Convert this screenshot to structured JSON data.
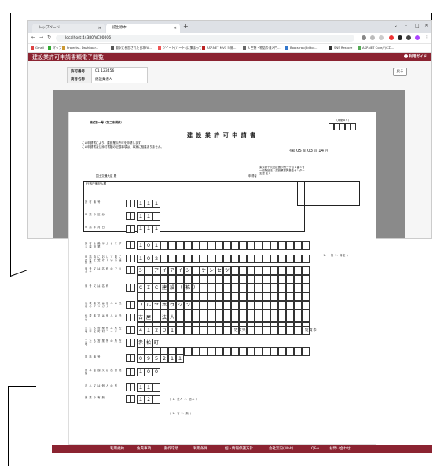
{
  "browser": {
    "tabs": [
      {
        "label": "トップページ"
      },
      {
        "label": "提出原本"
      }
    ],
    "url": "localhost:44380/VC00006",
    "bookmarks": [
      "Gmail",
      "マップ",
      "Projects - Dashboar...",
      "翻訳に参加された日本FA...",
      "ツイート(ハート)(に集まって...",
      "ASP.NET MVC 5 開...",
      "A 空想・物語の海入門...",
      "Bootstrap(Editor...",
      "SNS Restore",
      "ASP.NET Core/F/Cエ..."
    ]
  },
  "app": {
    "title": "建設業許可申請書類電子閲覧",
    "guide": "利用ガイド",
    "back": "戻る",
    "info": [
      {
        "key": "許可番号",
        "value": "01 123456"
      },
      {
        "key": "商号名称",
        "value": "建設業者A"
      }
    ]
  },
  "document": {
    "form_no": "様式第一号（第二条関係）",
    "stamp": "（用紙A４）",
    "title": "建 設 業 許 可 申 請 書",
    "intro1": "この申請書により、建設業の許可を申請します。",
    "intro2": "この申請書及び添付書類の記載事項は、事実に相違ありません。",
    "date": {
      "era": "令和",
      "y": "05",
      "y_unit": "年",
      "m": "03",
      "m_unit": "月",
      "d": "14",
      "d_unit": "日"
    },
    "addressee": "国土交通大臣 殿",
    "applicant": "申請者",
    "address_lines": [
      "東京都千代田区霞が関二丁目１番３号",
      "一般財団法人建設業振興基金センター",
      "古屋 五人"
    ],
    "section_header": "行政庁側記入欄",
    "fields": [
      {
        "label": "許 可 番 号",
        "chars": [
          "１",
          "１",
          "１"
        ]
      },
      {
        "label": "申 請 の 区 分",
        "chars": [
          "１",
          "１"
        ]
      },
      {
        "label": "申 請 年 月 日",
        "chars": [
          "１",
          "１",
          "１"
        ]
      },
      {
        "label": "許 可 を 受 け よ う と す る 建 設 業",
        "chars": [
          "１",
          "０",
          "１"
        ]
      },
      {
        "label": "申 請 時 に お い て 既 に 許 可 を 受 け て い る 建 設 業",
        "chars": [
          "１",
          "０",
          "２"
        ]
      },
      {
        "label": "商 号 又 は 名 称 の フ リ ガ ナ",
        "chars": [
          "シ",
          "ー",
          "ア",
          "イ",
          "ア",
          "イ",
          "シ",
          "ー",
          "ケ",
          "ン",
          "セ",
          "ツ"
        ]
      },
      {
        "label": "商 号 又 は 名 称",
        "chars": [
          "Ｃ",
          "Ｉ",
          "Ｃ",
          "建",
          "設",
          "（",
          "株",
          "）"
        ]
      },
      {
        "label": "代 表 者 又 は 個 人 の 氏 名 の フ リ ガ ナ",
        "chars": [
          "フ",
          "ル",
          "ヤ",
          "ホ",
          "ウ",
          "ジ",
          "ン"
        ]
      },
      {
        "label": "代 表 者 又 は 個 人 の 氏 名",
        "chars": [
          "古",
          "屋",
          "",
          "法",
          "人"
        ]
      },
      {
        "label": "主 た る 営 業 所 の 所 在 地 市 区 町 村 コ ー ド",
        "chars": [
          "４",
          "１",
          "２",
          "０",
          "１"
        ],
        "pref": "佐賀県",
        "city": "佐賀市"
      },
      {
        "label": "主 た る 営 業 所 の 所 在 地",
        "chars": [
          "赤",
          "松",
          "町"
        ]
      },
      {
        "label": "電 話 番 号",
        "chars": [
          "０",
          "９",
          "５",
          "２",
          "１",
          "１"
        ]
      },
      {
        "label": "資 本 金 額 又 は 出 資 総 額",
        "chars": [
          "１",
          "０",
          "０"
        ]
      },
      {
        "label": "法 人 又 は 個 人 の 別",
        "chars": [
          "１",
          "１"
        ]
      },
      {
        "label": "兼 業 の 有 無",
        "chars": [
          "１",
          "２"
        ]
      }
    ],
    "notes": {
      "kakko1": "（ 1. 一般 2. 特定 ）",
      "kakko2": "（ 1. 法人 2. 個人 ）",
      "kakko3": "（ 1. 有 2. 無 ）",
      "ban": "（代表）",
      "yen": "（千円）"
    }
  },
  "footer": {
    "links": [
      "利用規約",
      "免責事項",
      "動作環境",
      "利用条件",
      "個人情報保護方針",
      "会社案内(Web)",
      "Q&A",
      "お問い合わせ"
    ]
  }
}
